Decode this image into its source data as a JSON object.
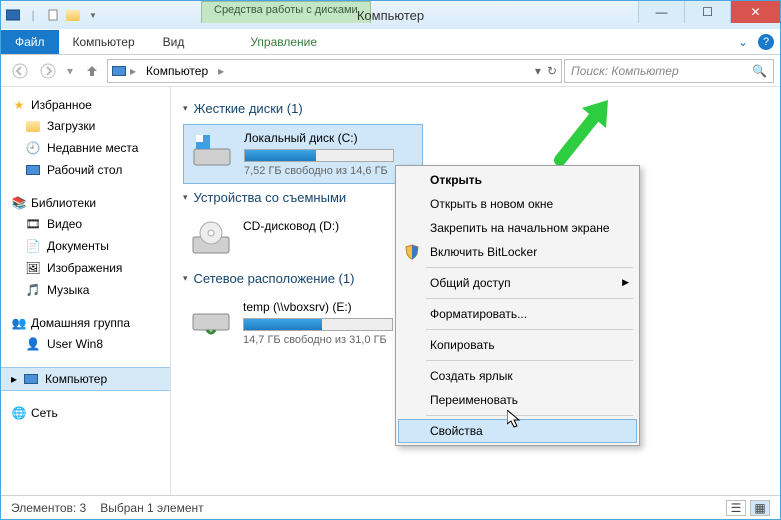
{
  "title": "Компьютер",
  "tools_tab": "Средства работы с дисками",
  "ribbon": {
    "file": "Файл",
    "computer": "Компьютер",
    "view": "Вид",
    "manage": "Управление"
  },
  "breadcrumb": "Компьютер",
  "search_placeholder": "Поиск: Компьютер",
  "sidebar": {
    "favorites": {
      "label": "Избранное",
      "items": [
        "Загрузки",
        "Недавние места",
        "Рабочий стол"
      ]
    },
    "libraries": {
      "label": "Библиотеки",
      "items": [
        "Видео",
        "Документы",
        "Изображения",
        "Музыка"
      ]
    },
    "homegroup": {
      "label": "Домашняя группа",
      "items": [
        "User Win8"
      ]
    },
    "computer": {
      "label": "Компьютер"
    },
    "network": {
      "label": "Сеть"
    }
  },
  "sections": {
    "hdd": {
      "title": "Жесткие диски (1)",
      "drive": {
        "name": "Локальный диск (C:)",
        "free": "7,52 ГБ свободно из 14,6 ГБ",
        "fill_pct": 48
      }
    },
    "removable": {
      "title": "Устройства со съемными",
      "drive": {
        "name": "CD-дисковод (D:)"
      }
    },
    "network": {
      "title": "Сетевое расположение (1)",
      "drive": {
        "name": "temp (\\\\vboxsrv) (E:)",
        "free": "14,7 ГБ свободно из 31,0 ГБ",
        "fill_pct": 53
      }
    }
  },
  "context_menu": [
    {
      "label": "Открыть",
      "bold": true
    },
    {
      "label": "Открыть в новом окне"
    },
    {
      "label": "Закрепить на начальном экране"
    },
    {
      "label": "Включить BitLocker",
      "icon": "shield"
    },
    {
      "sep": true
    },
    {
      "label": "Общий доступ",
      "submenu": true
    },
    {
      "sep": true
    },
    {
      "label": "Форматировать..."
    },
    {
      "sep": true
    },
    {
      "label": "Копировать"
    },
    {
      "sep": true
    },
    {
      "label": "Создать ярлык"
    },
    {
      "label": "Переименовать"
    },
    {
      "sep": true
    },
    {
      "label": "Свойства",
      "hover": true
    }
  ],
  "statusbar": {
    "count": "Элементов: 3",
    "selected": "Выбран 1 элемент"
  }
}
